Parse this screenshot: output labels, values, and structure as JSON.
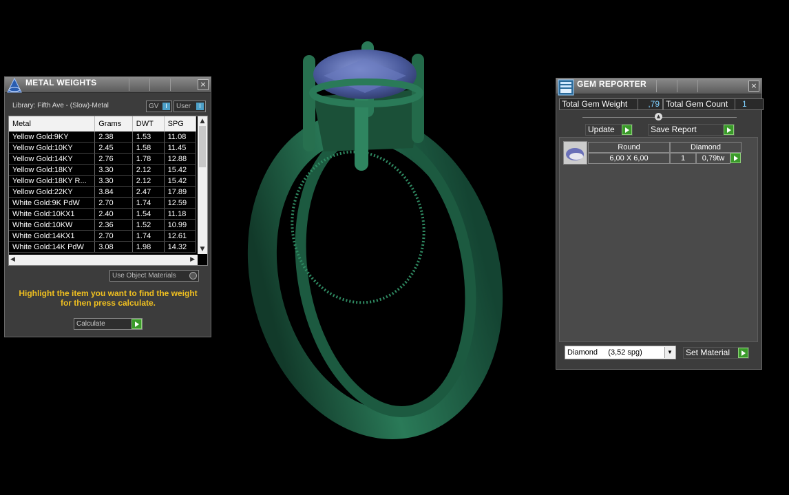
{
  "metal_weights": {
    "title": "METAL WEIGHTS",
    "library_label": "Library: Fifth Ave - (Slow)-Metal",
    "toggle_gv": "GV",
    "toggle_user": "User",
    "columns": [
      "Metal",
      "Grams",
      "DWT",
      "SPG"
    ],
    "rows": [
      [
        "Yellow Gold:9KY",
        "2.38",
        "1.53",
        "11.08"
      ],
      [
        "Yellow Gold:10KY",
        "2.45",
        "1.58",
        "11.45"
      ],
      [
        "Yellow Gold:14KY",
        "2.76",
        "1.78",
        "12.88"
      ],
      [
        "Yellow Gold:18KY",
        "3.30",
        "2.12",
        "15.42"
      ],
      [
        "Yellow Gold:18KY R...",
        "3.30",
        "2.12",
        "15.42"
      ],
      [
        "Yellow Gold:22KY",
        "3.84",
        "2.47",
        "17.89"
      ],
      [
        "White Gold:9K PdW",
        "2.70",
        "1.74",
        "12.59"
      ],
      [
        "White Gold:10KX1",
        "2.40",
        "1.54",
        "11.18"
      ],
      [
        "White Gold:10KW",
        "2.36",
        "1.52",
        "10.99"
      ],
      [
        "White Gold:14KX1",
        "2.70",
        "1.74",
        "12.61"
      ],
      [
        "White Gold:14K PdW",
        "3.08",
        "1.98",
        "14.32"
      ]
    ],
    "use_object_materials": "Use Object Materials",
    "hint": "Highlight the item you want to find the weight for then press calculate.",
    "calculate_label": "Calculate",
    "hint_color": "#f0c020"
  },
  "gem_reporter": {
    "title": "GEM REPORTER",
    "total_weight_label": "Total Gem Weight",
    "total_weight_value": ",79",
    "total_count_label": "Total Gem Count",
    "total_count_value": "1",
    "update_label": "Update",
    "save_report_label": "Save Report",
    "gem": {
      "shape": "Round",
      "material": "Diamond",
      "size": "6,00 X 6,00",
      "count": "1",
      "weight": "0,79tw"
    },
    "material_select": "Diamond     (3,52 spg)",
    "set_material_label": "Set Material"
  },
  "viewport": {
    "ring_color": "#1f5e44",
    "gem_color": "#5a6aaa",
    "icons": [
      "ring-model",
      "blue-gemstone"
    ]
  }
}
